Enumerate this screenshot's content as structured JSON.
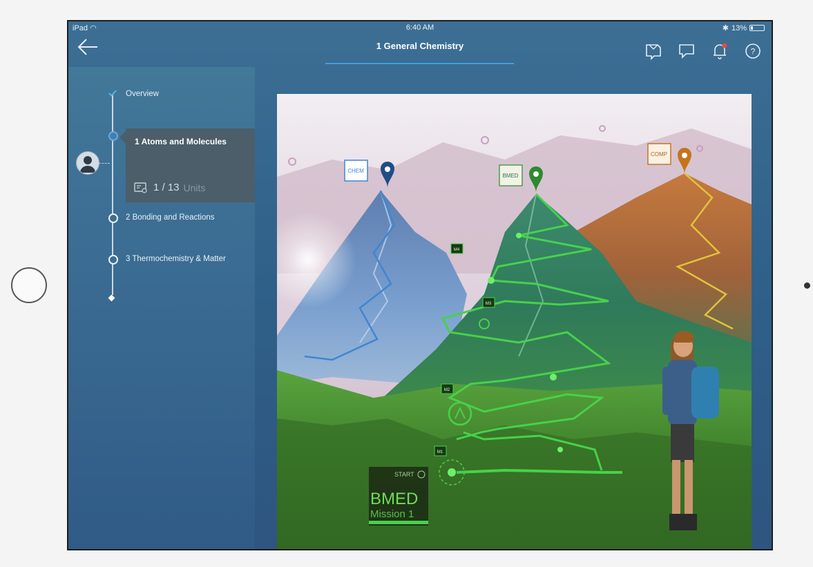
{
  "status_bar": {
    "carrier": "iPad",
    "time": "6:40 AM",
    "battery": "13%"
  },
  "nav": {
    "title": "1 General Chemistry"
  },
  "sidebar": {
    "items": [
      {
        "label": "Overview",
        "state": "completed"
      },
      {
        "label": "1 Atoms and Molecules",
        "state": "active",
        "progress_count": "1 / 13",
        "progress_label": "Units"
      },
      {
        "label": "2 Bonding and Reactions",
        "state": "locked"
      },
      {
        "label": "3 Thermochemistry & Matter",
        "state": "locked"
      }
    ]
  },
  "map": {
    "peaks": [
      {
        "tag": "CHEM",
        "color": "#3f86d1"
      },
      {
        "tag": "BMED",
        "color": "#47d14b"
      },
      {
        "tag": "COMP",
        "color": "#e0a03a"
      }
    ],
    "waypoint_labels": [
      "M4",
      "M3",
      "M2",
      "M1"
    ],
    "start_label": "START",
    "mission_title": "BMED",
    "mission_subtitle": "Mission 1"
  },
  "colors": {
    "accent": "#3aa2e4",
    "bmed_path": "#47d14b",
    "chem_path": "#3f86d1",
    "comp_path": "#e0c43a"
  }
}
